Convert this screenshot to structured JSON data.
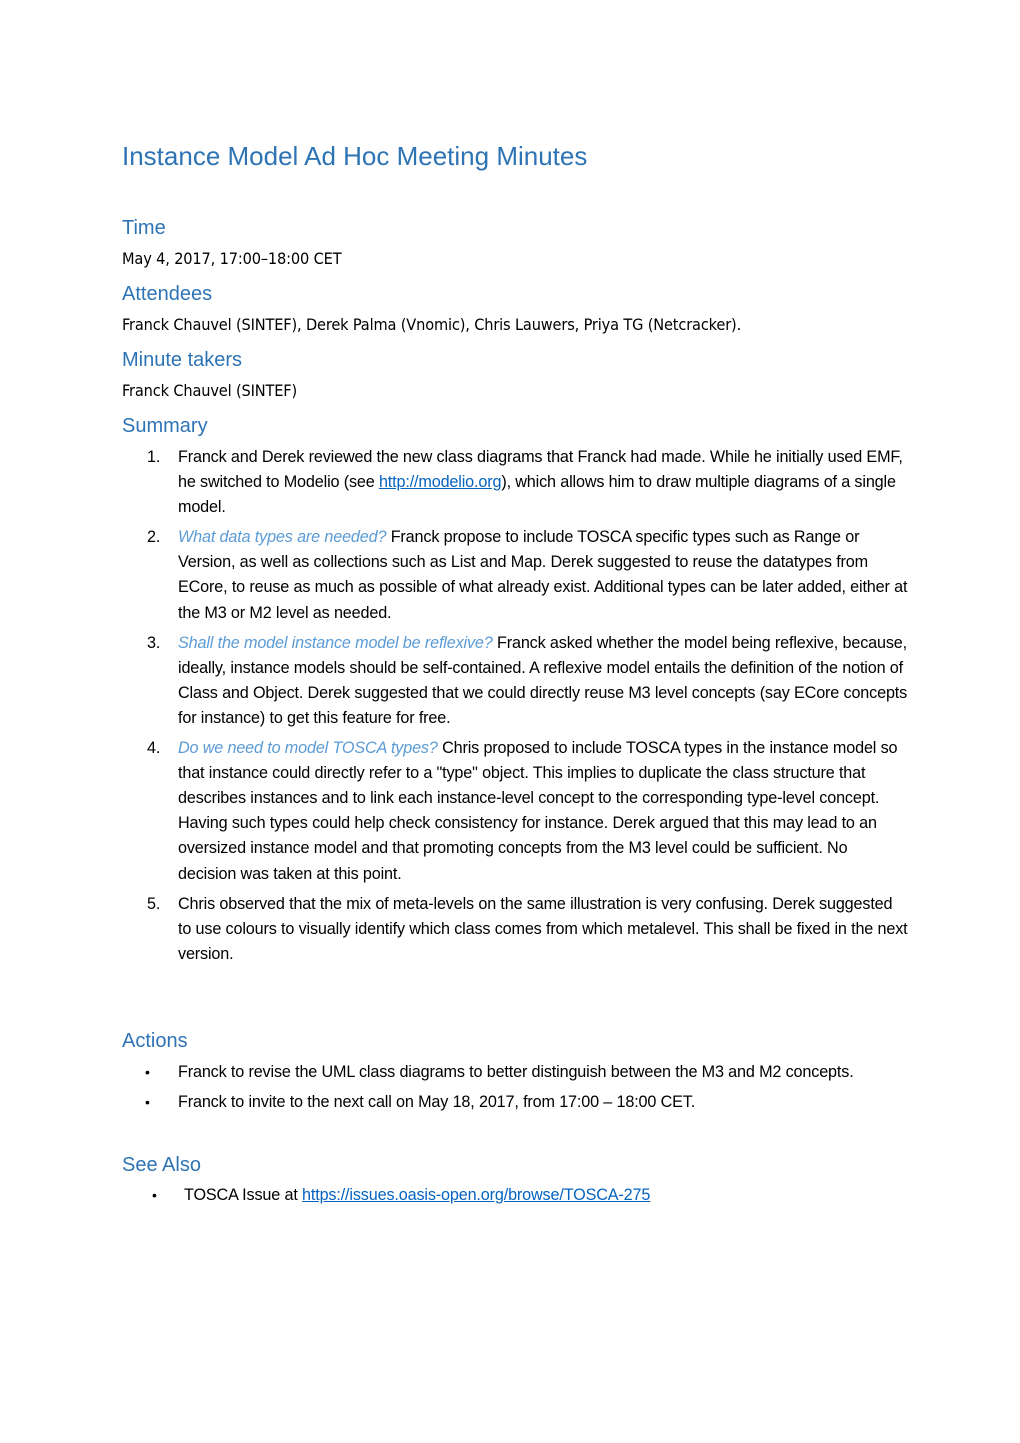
{
  "document": {
    "title": "Instance Model Ad Hoc Meeting Minutes",
    "sections": {
      "time": {
        "heading": "Time",
        "text": "May 4, 2017, 17:00–18:00 CET"
      },
      "attendees": {
        "heading": "Attendees",
        "text": "Franck Chauvel (SINTEF), Derek Palma (Vnomic), Chris Lauwers, Priya TG (Netcracker)."
      },
      "minute_takers": {
        "heading": "Minute takers",
        "text": "Franck Chauvel (SINTEF)"
      },
      "summary": {
        "heading": "Summary",
        "items": [
          {
            "number": "1.",
            "question": "",
            "text_before_link": "Franck and Derek reviewed the new class diagrams that Franck had made. While he initially used EMF, he switched to Modelio (see ",
            "link": "http://modelio.org",
            "text_after_link": "), which allows him to draw multiple diagrams of a single model."
          },
          {
            "number": "2.",
            "question": "What data types are needed?",
            "text": " Franck propose to include TOSCA specific types such as Range or Version, as well as collections such as List and Map. Derek suggested to reuse the datatypes from ECore, to reuse as much as possible of what already exist. Additional types can be later added, either at the M3 or M2 level as needed."
          },
          {
            "number": "3.",
            "question": "Shall the model instance model be reflexive?",
            "text": " Franck asked whether the model being reflexive, because, ideally, instance models should be self-contained. A reflexive model entails the definition of the notion of Class and Object. Derek suggested that we could directly reuse M3 level concepts (say ECore concepts for instance) to get this feature for free."
          },
          {
            "number": "4.",
            "question": "Do we need to model TOSCA types?",
            "text": " Chris proposed to include TOSCA types in the instance model so that instance could directly refer to a \"type\" object. This implies to duplicate the class structure that describes instances and to link each instance-level concept to the corresponding type-level concept. Having such types could help check consistency for instance. Derek argued that this may lead to an oversized instance model and that promoting concepts from the M3 level could be sufficient. No decision was taken at this point."
          },
          {
            "number": "5.",
            "question": "",
            "text": "Chris observed that the mix of meta-levels on the same illustration is very confusing. Derek suggested to use colours to visually identify which class comes from which metalevel. This shall be fixed in the next version."
          }
        ]
      },
      "actions": {
        "heading": "Actions",
        "bullet": "•",
        "items": [
          "Franck to revise the UML class diagrams to better distinguish between the M3 and M2 concepts.",
          "Franck to invite to the next call on May 18, 2017, from 17:00 – 18:00 CET."
        ]
      },
      "see_also": {
        "heading": "See Also",
        "bullet": "•",
        "items": [
          {
            "text": "TOSCA Issue at ",
            "link": "https://issues.oasis-open.org/browse/TOSCA-275"
          }
        ]
      }
    }
  },
  "colors": {
    "heading": "#2e74b5",
    "question": "#5b9bd5",
    "link": "#0563c1",
    "body_text": "#000000"
  }
}
